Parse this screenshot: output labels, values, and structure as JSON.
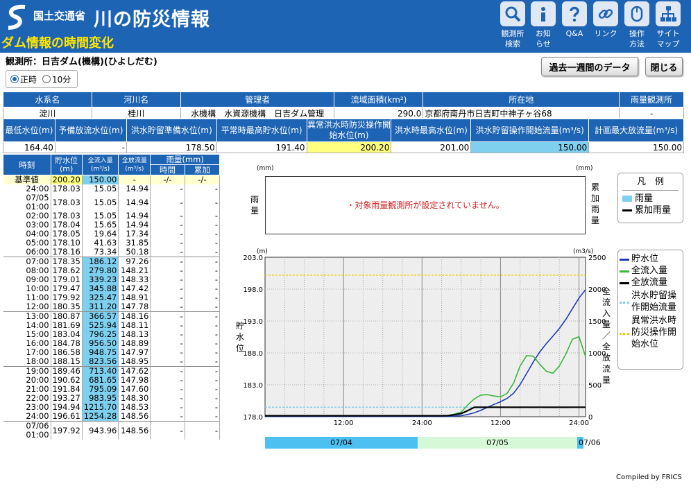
{
  "header": {
    "ministry": "国土交通省",
    "title": "川の防災情報",
    "subtitle": "ダム情報の時間変化",
    "nav": [
      {
        "label": "観測所\n検索",
        "icon": "search-icon"
      },
      {
        "label": "お知\nらせ",
        "icon": "info-icon"
      },
      {
        "label": "Q&A",
        "icon": "question-icon"
      },
      {
        "label": "リンク",
        "icon": "link-icon"
      },
      {
        "label": "操作\n方法",
        "icon": "mouse-icon"
      },
      {
        "label": "サイト\nマップ",
        "icon": "sitemap-icon"
      }
    ]
  },
  "station": {
    "label": "観測所：日吉ダム(機構)(ひよしだむ)"
  },
  "interval": {
    "options": [
      "正時",
      "10分"
    ],
    "selected": "正時"
  },
  "buttons": {
    "past_week": "過去一週間のデータ",
    "close": "閉じる"
  },
  "info1": {
    "headers": [
      "水系名",
      "河川名",
      "管理者",
      "流域面積(km²)",
      "所在地",
      "雨量観測所"
    ],
    "values": [
      "淀川",
      "桂川",
      "水機構　水資源機構　日吉ダム管理",
      "290.0",
      "京都府南丹市日吉町中神子ヶ谷68",
      "-"
    ]
  },
  "info2": {
    "headers": [
      "最低水位(m)",
      "予備放流水位(m)",
      "洪水貯留準備水位(m)",
      "平常時最高貯水位(m)",
      "異常洪水時防災操作開始水位(m)",
      "洪水時最高水位(m)",
      "洪水貯留操作開始流量(m³/s)",
      "計画最大放流量(m³/s)"
    ],
    "values": [
      "164.40",
      "-",
      "178.50",
      "191.40",
      "200.20",
      "201.00",
      "150.00",
      "150.00"
    ]
  },
  "timetable": {
    "headers": {
      "time": "時刻",
      "level": "貯水位\n(m)",
      "inflow": "全流入量\n(m³/s)",
      "outflow": "全放流量\n(m³/s)",
      "rain": "雨量(mm)",
      "rain_time": "時間",
      "rain_cum": "累加"
    },
    "baseline": {
      "label": "基準値",
      "level": "200.20",
      "inflow": "150.00",
      "outflow": "-",
      "rain_time": "-/-",
      "rain_cum": "-/-"
    },
    "rows": [
      {
        "time": "24:00",
        "level": "178.03",
        "inflow": "15.05",
        "outflow": "14.94",
        "rt": "-",
        "rc": "-"
      },
      {
        "time": "07/05\n01:00",
        "level": "178.03",
        "inflow": "15.05",
        "outflow": "14.94",
        "rt": "-",
        "rc": "-"
      },
      {
        "time": "02:00",
        "level": "178.03",
        "inflow": "15.05",
        "outflow": "14.94",
        "rt": "-",
        "rc": "-"
      },
      {
        "time": "03:00",
        "level": "178.04",
        "inflow": "15.65",
        "outflow": "14.94",
        "rt": "-",
        "rc": "-"
      },
      {
        "time": "04:00",
        "level": "178.05",
        "inflow": "19.64",
        "outflow": "17.34",
        "rt": "-",
        "rc": "-"
      },
      {
        "time": "05:00",
        "level": "178.10",
        "inflow": "41.63",
        "outflow": "31.85",
        "rt": "-",
        "rc": "-"
      },
      {
        "time": "06:00",
        "level": "178.16",
        "inflow": "73.34",
        "outflow": "50.18",
        "rt": "-",
        "rc": "-"
      },
      {
        "time": "07:00",
        "level": "178.35",
        "inflow": "186.12",
        "outflow": "97.26",
        "rt": "-",
        "rc": "-"
      },
      {
        "time": "08:00",
        "level": "178.62",
        "inflow": "279.80",
        "outflow": "148.21",
        "rt": "-",
        "rc": "-"
      },
      {
        "time": "09:00",
        "level": "179.01",
        "inflow": "339.23",
        "outflow": "148.33",
        "rt": "-",
        "rc": "-"
      },
      {
        "time": "10:00",
        "level": "179.47",
        "inflow": "345.88",
        "outflow": "147.42",
        "rt": "-",
        "rc": "-"
      },
      {
        "time": "11:00",
        "level": "179.92",
        "inflow": "325.47",
        "outflow": "148.91",
        "rt": "-",
        "rc": "-"
      },
      {
        "time": "12:00",
        "level": "180.35",
        "inflow": "311.20",
        "outflow": "147.78",
        "rt": "-",
        "rc": "-"
      },
      {
        "time": "13:00",
        "level": "180.87",
        "inflow": "366.57",
        "outflow": "148.16",
        "rt": "-",
        "rc": "-"
      },
      {
        "time": "14:00",
        "level": "181.69",
        "inflow": "525.94",
        "outflow": "148.11",
        "rt": "-",
        "rc": "-"
      },
      {
        "time": "15:00",
        "level": "183.04",
        "inflow": "796.25",
        "outflow": "148.13",
        "rt": "-",
        "rc": "-"
      },
      {
        "time": "16:00",
        "level": "184.78",
        "inflow": "956.50",
        "outflow": "148.89",
        "rt": "-",
        "rc": "-"
      },
      {
        "time": "17:00",
        "level": "186.58",
        "inflow": "948.75",
        "outflow": "147.97",
        "rt": "-",
        "rc": "-"
      },
      {
        "time": "18:00",
        "level": "188.15",
        "inflow": "823.56",
        "outflow": "148.95",
        "rt": "-",
        "rc": "-"
      },
      {
        "time": "19:00",
        "level": "189.46",
        "inflow": "713.40",
        "outflow": "147.62",
        "rt": "-",
        "rc": "-"
      },
      {
        "time": "20:00",
        "level": "190.62",
        "inflow": "681.65",
        "outflow": "147.98",
        "rt": "-",
        "rc": "-"
      },
      {
        "time": "21:00",
        "level": "191.84",
        "inflow": "795.09",
        "outflow": "147.60",
        "rt": "-",
        "rc": "-"
      },
      {
        "time": "22:00",
        "level": "193.27",
        "inflow": "983.95",
        "outflow": "148.30",
        "rt": "-",
        "rc": "-"
      },
      {
        "time": "23:00",
        "level": "194.94",
        "inflow": "1215.70",
        "outflow": "148.53",
        "rt": "-",
        "rc": "-"
      },
      {
        "time": "24:00",
        "level": "196.61",
        "inflow": "1254.28",
        "outflow": "148.56",
        "rt": "-",
        "rc": "-"
      },
      {
        "time": "07/06\n01:00",
        "level": "197.92",
        "inflow": "943.96",
        "outflow": "148.56",
        "rt": "-",
        "rc": "-"
      }
    ]
  },
  "rain_chart": {
    "unit_left": "(mm)",
    "unit_right": "(mm)",
    "left_label": "雨量",
    "right_label": "累加雨量",
    "message": "・対象雨量観測所が設定されていません。"
  },
  "legend_rain": {
    "title": "凡　例",
    "items": [
      {
        "label": "雨量",
        "color": "#7fcfee"
      },
      {
        "label": "累加雨量",
        "color": "#000000"
      }
    ]
  },
  "legend_main": {
    "items": [
      {
        "label": "貯水位",
        "color": "#1e3cb4",
        "style": "solid"
      },
      {
        "label": "全流入量",
        "color": "#3cb43c",
        "style": "solid"
      },
      {
        "label": "全放流量",
        "color": "#000000",
        "style": "solid"
      },
      {
        "label": "洪水貯留操作開始流量",
        "color": "#7fcfee",
        "style": "dashed"
      },
      {
        "label": "異常洪水時防災操作開始水位",
        "color": "#e6d200",
        "style": "dashed"
      }
    ]
  },
  "chart_data": {
    "type": "line",
    "unit_left": "(m)",
    "unit_right": "(m3/s)",
    "ylabel_left": "貯水位",
    "ylabel_right": "全流入量／全放流量",
    "ylim_left": [
      178.0,
      203.0
    ],
    "ylim_right": [
      0,
      2500
    ],
    "yticks_left": [
      "178.0",
      "183.0",
      "188.0",
      "193.0",
      "198.0",
      "203.0"
    ],
    "yticks_right": [
      "0",
      "500",
      "1000",
      "1500",
      "2000",
      "2500"
    ],
    "xticks": [
      "12:00",
      "24:00",
      "12:00",
      "24:00"
    ],
    "dates": [
      "07/04",
      "07/05",
      "07/06"
    ],
    "series": [
      {
        "name": "貯水位",
        "axis": "left",
        "values": [
          178.03,
          178.03,
          178.03,
          178.04,
          178.05,
          178.1,
          178.16,
          178.35,
          178.62,
          179.01,
          179.47,
          179.92,
          180.35,
          180.87,
          181.69,
          183.04,
          184.78,
          186.58,
          188.15,
          189.46,
          190.62,
          191.84,
          193.27,
          194.94,
          196.61,
          197.92
        ]
      },
      {
        "name": "全流入量",
        "axis": "right",
        "values": [
          15.05,
          15.05,
          15.05,
          15.65,
          19.64,
          41.63,
          73.34,
          186.12,
          279.8,
          339.23,
          345.88,
          325.47,
          311.2,
          366.57,
          525.94,
          796.25,
          956.5,
          948.75,
          823.56,
          713.4,
          681.65,
          795.09,
          983.95,
          1215.7,
          1254.28,
          943.96
        ]
      },
      {
        "name": "全放流量",
        "axis": "right",
        "values": [
          14.94,
          14.94,
          14.94,
          14.94,
          17.34,
          31.85,
          50.18,
          97.26,
          148.21,
          148.33,
          147.42,
          148.91,
          147.78,
          148.16,
          148.11,
          148.13,
          148.89,
          147.97,
          148.95,
          147.62,
          147.98,
          147.6,
          148.3,
          148.53,
          148.56,
          148.56
        ]
      }
    ],
    "reference_lines": [
      {
        "name": "洪水貯留操作開始流量",
        "axis": "right",
        "value": 150.0
      },
      {
        "name": "異常洪水時防災操作開始水位",
        "axis": "left",
        "value": 200.2
      }
    ]
  },
  "footer": {
    "compiled": "Compiled by FRICS"
  }
}
